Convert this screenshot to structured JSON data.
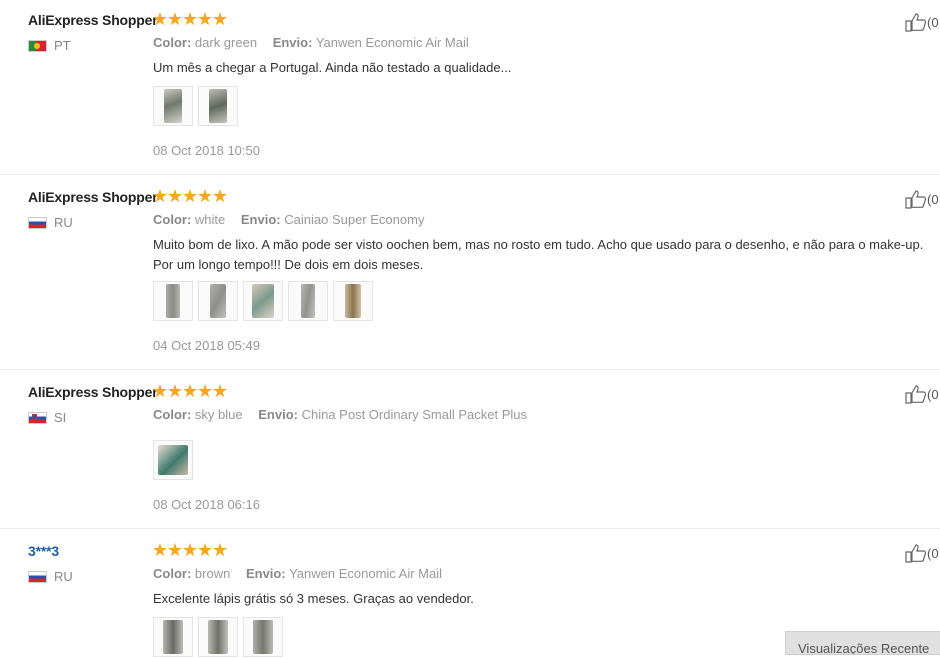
{
  "labels": {
    "color": "Color:",
    "shipping": "Envio:"
  },
  "like_count": "(0",
  "recent_views": "Visualizações Recente",
  "reviews": [
    {
      "user": "AliExpress Shopper",
      "country": "PT",
      "flag": "portugal-flag-icon",
      "rating": 5,
      "color": "dark green",
      "shipping": "Yanwen Economic Air Mail",
      "text": "Um mês a chegar a Portugal. Ainda não testado a qualidade...",
      "photo_count": 2,
      "date": "08 Oct 2018 10:50"
    },
    {
      "user": "AliExpress Shopper",
      "country": "RU",
      "flag": "russia-flag-icon",
      "rating": 5,
      "color": "white",
      "shipping": "Cainiao Super Economy",
      "text": "Muito bom de lixo. A mão pode ser visto oochen bem, mas no rosto em tudo. Acho que usado para o desenho, e não para o make-up. Por um longo tempo!!! De dois em dois meses.",
      "photo_count": 5,
      "date": "04 Oct 2018 05:49"
    },
    {
      "user": "AliExpress Shopper",
      "country": "SI",
      "flag": "slovenia-flag-icon",
      "rating": 5,
      "color": "sky blue",
      "shipping": "China Post Ordinary Small Packet Plus",
      "text": "",
      "photo_count": 1,
      "date": "08 Oct 2018 06:16"
    },
    {
      "user": "3***3",
      "country": "RU",
      "flag": "russia-flag-icon",
      "rating": 5,
      "color": "brown",
      "shipping": "Yanwen Economic Air Mail",
      "text": "Excelente lápis grátis só 3 meses. Graças ao vendedor.",
      "photo_count": 3,
      "date": ""
    }
  ]
}
